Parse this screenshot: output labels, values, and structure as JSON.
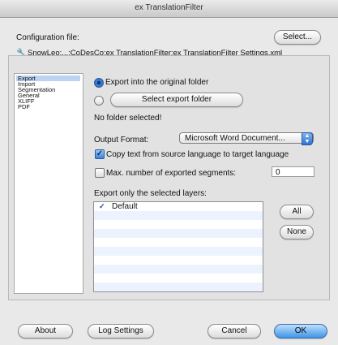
{
  "window": {
    "title": "ex TranslationFilter"
  },
  "config": {
    "label": "Configuration file:",
    "select_button": "Select...",
    "path": "SnowLeo:...:CoDesCo:ex TranslationFilter:ex TranslationFilter Settings.xml",
    "path_icon": "wrench-icon"
  },
  "sidebar": {
    "items": [
      {
        "label": "Export",
        "selected": true
      },
      {
        "label": "Import",
        "selected": false
      },
      {
        "label": "Segmentation",
        "selected": false
      },
      {
        "label": "General",
        "selected": false
      },
      {
        "label": "XLIFF",
        "selected": false
      },
      {
        "label": "PDF",
        "selected": false
      }
    ]
  },
  "export": {
    "radio_original_label": "Export into the original folder",
    "radio_original_selected": true,
    "select_folder_button": "Select export folder",
    "radio_folder_selected": false,
    "no_folder_text": "No folder selected!",
    "output_format_label": "Output Format:",
    "output_format_value": "Microsoft Word Document...",
    "copy_text_label": "Copy text from source language to target language",
    "copy_text_checked": true,
    "max_segments_label": "Max. number of exported segments:",
    "max_segments_checked": false,
    "max_segments_value": "0",
    "layers_label": "Export only the selected layers:",
    "layers": [
      {
        "name": "Default",
        "checked": true
      }
    ],
    "all_button": "All",
    "none_button": "None"
  },
  "footer": {
    "about_button": "About",
    "log_settings_button": "Log Settings",
    "cancel_button": "Cancel",
    "ok_button": "OK"
  },
  "colors": {
    "accent": "#3f94e6",
    "selection": "#bcd3f2",
    "window_bg": "#e9e9e9"
  }
}
